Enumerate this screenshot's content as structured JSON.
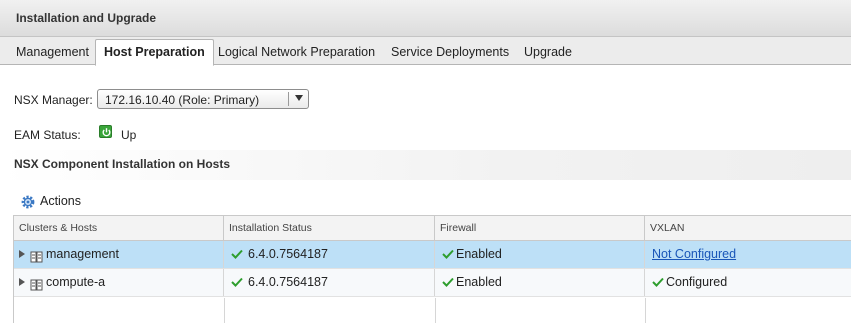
{
  "header": {
    "title": "Installation and Upgrade"
  },
  "tabs": [
    {
      "label": "Management"
    },
    {
      "label": "Host Preparation"
    },
    {
      "label": "Logical Network Preparation"
    },
    {
      "label": "Service Deployments"
    },
    {
      "label": "Upgrade"
    }
  ],
  "active_tab": "Host Preparation",
  "nsx_manager": {
    "label": "NSX Manager:",
    "value": "172.16.10.40 (Role: Primary)"
  },
  "eam_status": {
    "label": "EAM Status:",
    "value": "Up",
    "icon": "power-on-icon",
    "color": "#3aa53a"
  },
  "section": {
    "title": "NSX Component Installation on Hosts"
  },
  "actions": {
    "label": "Actions",
    "icon": "gear-icon"
  },
  "table": {
    "columns": [
      "Clusters & Hosts",
      "Installation Status",
      "Firewall",
      "VXLAN"
    ],
    "rows": [
      {
        "name": "management",
        "install": "6.4.0.7564187",
        "firewall": "Enabled",
        "vxlan": "Not Configured",
        "selected": true
      },
      {
        "name": "compute-a",
        "install": "6.4.0.7564187",
        "firewall": "Enabled",
        "vxlan": "Configured",
        "selected": false
      }
    ]
  },
  "colors": {
    "selected_row": "#bde0f7",
    "check_green": "#2e9e2e",
    "link": "#1a56b8"
  }
}
